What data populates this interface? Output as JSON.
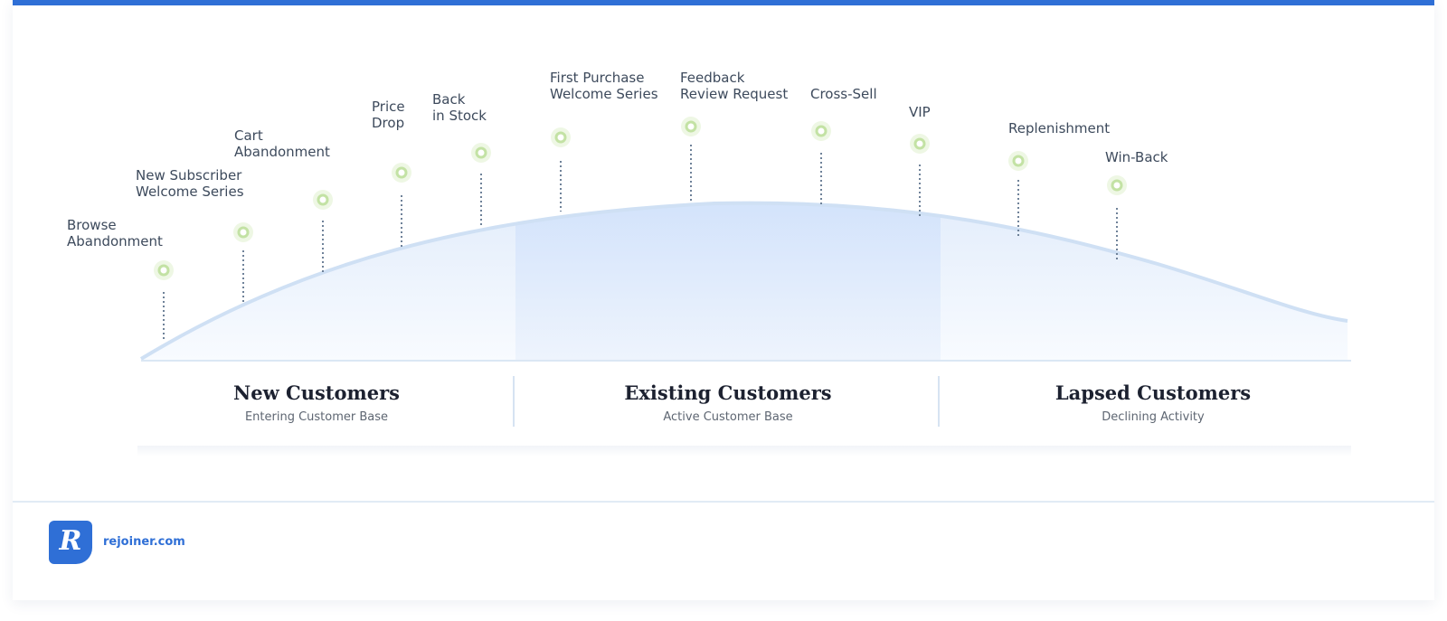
{
  "milestones": [
    {
      "id": "browse",
      "lines": [
        "Browse",
        "Abandonment"
      ]
    },
    {
      "id": "new-subscriber",
      "lines": [
        "New Subscriber",
        "Welcome Series"
      ]
    },
    {
      "id": "cart",
      "lines": [
        "Cart",
        "Abandonment"
      ]
    },
    {
      "id": "price-drop",
      "lines": [
        "Price",
        "Drop"
      ]
    },
    {
      "id": "back-in-stock",
      "lines": [
        "Back",
        "in Stock"
      ]
    },
    {
      "id": "first-purchase",
      "lines": [
        "First Purchase",
        "Welcome Series"
      ]
    },
    {
      "id": "feedback",
      "lines": [
        "Feedback",
        "Review Request"
      ]
    },
    {
      "id": "cross-sell",
      "lines": [
        "Cross-Sell"
      ]
    },
    {
      "id": "vip",
      "lines": [
        "VIP"
      ]
    },
    {
      "id": "replenishment",
      "lines": [
        "Replenishment"
      ]
    },
    {
      "id": "win-back",
      "lines": [
        "Win-Back"
      ]
    }
  ],
  "sections": [
    {
      "title": "New Customers",
      "subtitle": "Entering Customer Base"
    },
    {
      "title": "Existing Customers",
      "subtitle": "Active Customer Base"
    },
    {
      "title": "Lapsed Customers",
      "subtitle": "Declining Activity"
    }
  ],
  "footer": {
    "logo_letter": "R",
    "site": "rejoiner.com"
  },
  "colors": {
    "accent": "#2f6fd6",
    "marker": "#c3e2a4",
    "curve": "#cfe0f4",
    "stem": "#6f8299"
  }
}
